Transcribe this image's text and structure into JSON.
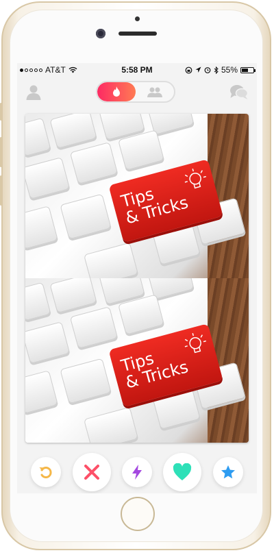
{
  "status_bar": {
    "carrier": "AT&T",
    "time": "5:58 PM",
    "battery": "55%",
    "battery_level": 0.55,
    "signal_bars": 1
  },
  "nav": {
    "left_icon": "profile-icon",
    "center_toggle": [
      "flame-icon",
      "people-icon"
    ],
    "right_icon": "chat-bubbles-icon",
    "accent": "#fd2a63"
  },
  "card": {
    "photos": [
      {
        "label_line1": "Tips",
        "label_line2": "& Tricks"
      },
      {
        "label_line1": "Tips",
        "label_line2": "& Tricks"
      }
    ]
  },
  "actions": [
    {
      "name": "rewind",
      "icon": "undo-icon",
      "color": "#f5b748"
    },
    {
      "name": "nope",
      "icon": "close-icon",
      "color": "#fd5068"
    },
    {
      "name": "boost",
      "icon": "lightning-icon",
      "color": "#a448e0"
    },
    {
      "name": "like",
      "icon": "heart-icon",
      "color": "#2ee0b8"
    },
    {
      "name": "super-like",
      "icon": "star-icon",
      "color": "#2e9cf1"
    }
  ]
}
